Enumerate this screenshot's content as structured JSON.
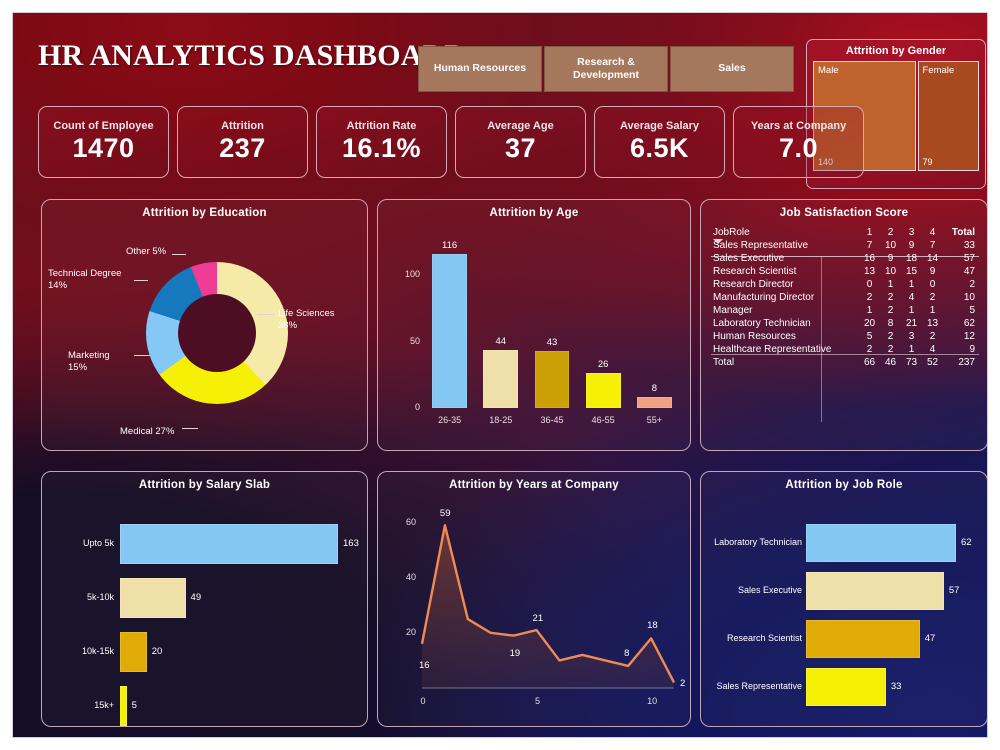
{
  "header": {
    "title": "HR ANALYTICS DASHBOARD",
    "dept_filters": [
      {
        "label": "Human Resources"
      },
      {
        "label": "Research & Development"
      },
      {
        "label": "Sales"
      }
    ],
    "kpis": [
      {
        "label": "Count of Employee",
        "value": "1470"
      },
      {
        "label": "Attrition",
        "value": "237"
      },
      {
        "label": "Attrition Rate",
        "value": "16.1%"
      },
      {
        "label": "Average Age",
        "value": "37"
      },
      {
        "label": "Average Salary",
        "value": "6.5K"
      },
      {
        "label": "Years at Company",
        "value": "7.0"
      }
    ]
  },
  "gender": {
    "title": "Attrition by Gender",
    "cells": [
      {
        "label": "Male",
        "value": "140",
        "color": "#c0622c"
      },
      {
        "label": "Female",
        "value": "79",
        "color": "#a8491f"
      }
    ]
  },
  "panels": {
    "education": "Attrition by Education",
    "age": "Attrition by Age",
    "satisfaction": "Job Satisfaction Score",
    "salary": "Attrition by Salary Slab",
    "years": "Attrition by Years at Company",
    "jobrole": "Attrition by Job Role"
  },
  "satisfaction_table": {
    "row_header": "JobRole",
    "columns": [
      "1",
      "2",
      "3",
      "4"
    ],
    "total_header": "Total",
    "rows": [
      {
        "role": "Sales Representative",
        "scores": [
          "7",
          "10",
          "9",
          "7"
        ],
        "total": "33"
      },
      {
        "role": "Sales Executive",
        "scores": [
          "16",
          "9",
          "18",
          "14"
        ],
        "total": "57"
      },
      {
        "role": "Research Scientist",
        "scores": [
          "13",
          "10",
          "15",
          "9"
        ],
        "total": "47"
      },
      {
        "role": "Research Director",
        "scores": [
          "0",
          "1",
          "1",
          "0"
        ],
        "total": "2"
      },
      {
        "role": "Manufacturing Director",
        "scores": [
          "2",
          "2",
          "4",
          "2"
        ],
        "total": "10"
      },
      {
        "role": "Manager",
        "scores": [
          "1",
          "2",
          "1",
          "1"
        ],
        "total": "5"
      },
      {
        "role": "Laboratory Technician",
        "scores": [
          "20",
          "8",
          "21",
          "13"
        ],
        "total": "62"
      },
      {
        "role": "Human Resources",
        "scores": [
          "5",
          "2",
          "3",
          "2"
        ],
        "total": "12"
      },
      {
        "role": "Healthcare Representative",
        "scores": [
          "2",
          "2",
          "1",
          "4"
        ],
        "total": "9"
      }
    ],
    "total_row": {
      "role": "Total",
      "scores": [
        "66",
        "46",
        "73",
        "52"
      ],
      "total": "237"
    }
  },
  "chart_data": [
    {
      "type": "pie",
      "title": "Attrition by Education",
      "labels": [
        "Life Sciences",
        "Medical",
        "Marketing",
        "Technical Degree",
        "Other"
      ],
      "values": [
        38,
        27,
        15,
        14,
        5
      ],
      "value_labels": [
        "Life Sciences\n38%",
        "Medical 27%",
        "Marketing\n15%",
        "Technical Degree\n14%",
        "Other 5%"
      ],
      "unit": "%",
      "colors": [
        "#f6eaa8",
        "#f6f006",
        "#85c8f5",
        "#1679bd",
        "#ef3d96"
      ],
      "donut": true,
      "legend": "labels-outside"
    },
    {
      "type": "bar",
      "title": "Attrition by Age",
      "categories": [
        "26-35",
        "18-25",
        "36-45",
        "46-55",
        "55+"
      ],
      "values": [
        116,
        44,
        43,
        26,
        8
      ],
      "colors": [
        "#84c7f2",
        "#efdfa8",
        "#caa005",
        "#f6f006",
        "#f0a182"
      ],
      "xlabel": "",
      "ylabel": "",
      "ylim": [
        0,
        125
      ],
      "yticks": [
        0,
        50,
        100
      ],
      "grid": false,
      "orientation": "vertical"
    },
    {
      "type": "bar",
      "title": "Attrition by Salary Slab",
      "categories": [
        "Upto 5k",
        "5k-10k",
        "10k-15k",
        "15k+"
      ],
      "values": [
        163,
        49,
        20,
        5
      ],
      "colors": [
        "#84c7f2",
        "#efdfa8",
        "#e0ab07",
        "#f6f006"
      ],
      "xlim": [
        0,
        163
      ],
      "grid": false,
      "orientation": "horizontal"
    },
    {
      "type": "area",
      "title": "Attrition by Years at Company",
      "x": [
        0,
        1,
        2,
        3,
        4,
        5,
        6,
        7,
        8,
        9,
        10,
        11
      ],
      "values": [
        16,
        59,
        25,
        20,
        19,
        21,
        10,
        12,
        10,
        8,
        18,
        2
      ],
      "labeled_points": [
        {
          "x": 0,
          "y": 16,
          "label": "16"
        },
        {
          "x": 1,
          "y": 59,
          "label": "59"
        },
        {
          "x": 4,
          "y": 19,
          "label": "19"
        },
        {
          "x": 5,
          "y": 21,
          "label": "21"
        },
        {
          "x": 9,
          "y": 8,
          "label": "8"
        },
        {
          "x": 10,
          "y": 18,
          "label": "18"
        },
        {
          "x": 11,
          "y": 2,
          "label": "2"
        }
      ],
      "xticks": [
        0,
        5,
        10
      ],
      "yticks": [
        20,
        40,
        60
      ],
      "ylim": [
        0,
        66
      ],
      "xlim": [
        0,
        11
      ],
      "line_color": "#ef8b52",
      "grid": false
    },
    {
      "type": "bar",
      "title": "Attrition by Job Role",
      "categories": [
        "Laboratory Technician",
        "Sales Executive",
        "Research Scientist",
        "Sales Representative"
      ],
      "values": [
        62,
        57,
        47,
        33
      ],
      "colors": [
        "#84c7f2",
        "#efdfa8",
        "#e0ab07",
        "#f6f006"
      ],
      "xlim": [
        0,
        62
      ],
      "grid": false,
      "orientation": "horizontal"
    },
    {
      "type": "treemap",
      "title": "Attrition by Gender",
      "labels": [
        "Male",
        "Female"
      ],
      "values": [
        140,
        79
      ],
      "colors": [
        "#c0622c",
        "#a8491f"
      ]
    }
  ]
}
